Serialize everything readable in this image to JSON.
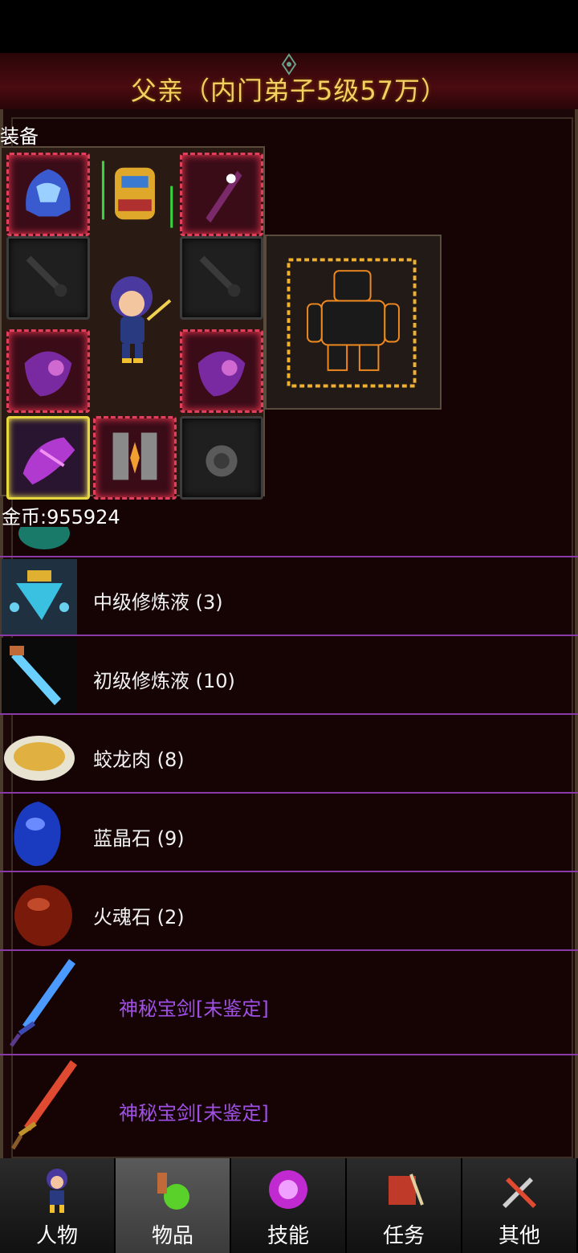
{
  "header": {
    "title": "父亲（内门弟子5级57万）"
  },
  "equipment": {
    "section_title": "装备"
  },
  "gold": {
    "label": "金币:955924"
  },
  "items": [
    {
      "label": "中级修炼液 (3)",
      "icon": "elixir-vial-icon"
    },
    {
      "label": "初级修炼液 (10)",
      "icon": "potion-tube-icon"
    },
    {
      "label": "蛟龙肉 (8)",
      "icon": "meat-plate-icon"
    },
    {
      "label": "蓝晶石 (9)",
      "icon": "blue-crystal-icon"
    },
    {
      "label": "火魂石 (2)",
      "icon": "red-stone-icon"
    },
    {
      "label": "神秘宝剑[未鉴定]",
      "icon": "blue-sword-icon"
    },
    {
      "label": "神秘宝剑[未鉴定]",
      "icon": "red-sword-icon"
    }
  ],
  "tabs": [
    {
      "label": "人物",
      "icon": "character-icon"
    },
    {
      "label": "物品",
      "icon": "potion-bag-icon"
    },
    {
      "label": "技能",
      "icon": "magic-orb-icon"
    },
    {
      "label": "任务",
      "icon": "scroll-icon"
    },
    {
      "label": "其他",
      "icon": "swords-icon"
    }
  ],
  "colors": {
    "accent_gold": "#f3d160",
    "item_purple": "#a050e6",
    "divider": "#8a3aa6"
  }
}
